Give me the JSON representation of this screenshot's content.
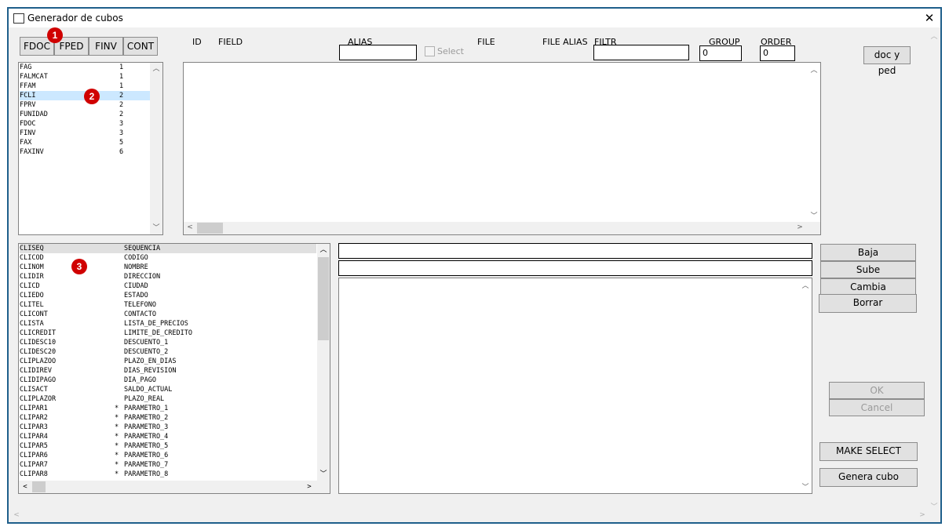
{
  "window": {
    "title": "Generador de cubos",
    "close_glyph": "✕"
  },
  "tabs": [
    "FDOC",
    "FPED",
    "FINV",
    "CONT"
  ],
  "headers": {
    "id": "ID",
    "field": "FIELD",
    "alias": "ALIAS",
    "select": "Select",
    "file": "FILE",
    "file_alias": "FILE ALIAS",
    "filtr": "FILTR",
    "group": "GROUP",
    "order": "ORDER"
  },
  "inputs": {
    "alias": "",
    "filtr": "",
    "group": "0",
    "order": "0"
  },
  "buttons": {
    "doc_ped": "doc y ped",
    "baja": "Baja",
    "sube": "Sube",
    "cambia": "Cambia",
    "borrar": "Borrar",
    "ok": "OK",
    "cancel": "Cancel",
    "make_select": "MAKE SELECT",
    "genera_cubo": "Genera cubo"
  },
  "tables_list": [
    {
      "name": "FAG",
      "value": "1"
    },
    {
      "name": "FALMCAT",
      "value": "1"
    },
    {
      "name": "FFAM",
      "value": "1"
    },
    {
      "name": "FCLI",
      "value": "2"
    },
    {
      "name": "FPRV",
      "value": "2"
    },
    {
      "name": "FUNIDAD",
      "value": "2"
    },
    {
      "name": "FDOC",
      "value": "3"
    },
    {
      "name": "FINV",
      "value": "3"
    },
    {
      "name": "FAX",
      "value": "5"
    },
    {
      "name": "FAXINV",
      "value": "6"
    }
  ],
  "selected_table_index": 3,
  "fields_list": [
    {
      "code": "CLISEQ",
      "mark": "",
      "desc": "SEQUENCIA"
    },
    {
      "code": "CLICOD",
      "mark": "",
      "desc": "CODIGO"
    },
    {
      "code": "CLINOM",
      "mark": "",
      "desc": "NOMBRE"
    },
    {
      "code": "CLIDIR",
      "mark": "",
      "desc": "DIRECCION"
    },
    {
      "code": "CLICD",
      "mark": "",
      "desc": "CIUDAD"
    },
    {
      "code": "CLIEDO",
      "mark": "",
      "desc": "ESTADO"
    },
    {
      "code": "CLITEL",
      "mark": "",
      "desc": "TELEFONO"
    },
    {
      "code": "CLICONT",
      "mark": "",
      "desc": "CONTACTO"
    },
    {
      "code": "CLISTA",
      "mark": "",
      "desc": "LISTA_DE_PRECIOS"
    },
    {
      "code": "CLICREDIT",
      "mark": "",
      "desc": "LIMITE_DE_CREDITO"
    },
    {
      "code": "CLIDESC10",
      "mark": "",
      "desc": "DESCUENTO_1"
    },
    {
      "code": "CLIDESC20",
      "mark": "",
      "desc": "DESCUENTO_2"
    },
    {
      "code": "CLIPLAZOO",
      "mark": "",
      "desc": "PLAZO_EN_DIAS"
    },
    {
      "code": "CLIDIREV",
      "mark": "",
      "desc": "DIAS_REVISION"
    },
    {
      "code": "CLIDIPAGO",
      "mark": "",
      "desc": "DIA_PAGO"
    },
    {
      "code": "CLISACT",
      "mark": "",
      "desc": "SALDO_ACTUAL"
    },
    {
      "code": "CLIPLAZOR",
      "mark": "",
      "desc": "PLAZO_REAL"
    },
    {
      "code": "CLIPAR1",
      "mark": "*",
      "desc": "PARAMETRO_1"
    },
    {
      "code": "CLIPAR2",
      "mark": "*",
      "desc": "PARAMETRO_2"
    },
    {
      "code": "CLIPAR3",
      "mark": "*",
      "desc": "PARAMETRO_3"
    },
    {
      "code": "CLIPAR4",
      "mark": "*",
      "desc": "PARAMETRO_4"
    },
    {
      "code": "CLIPAR5",
      "mark": "*",
      "desc": "PARAMETRO_5"
    },
    {
      "code": "CLIPAR6",
      "mark": "*",
      "desc": "PARAMETRO_6"
    },
    {
      "code": "CLIPAR7",
      "mark": "*",
      "desc": "PARAMETRO_7"
    },
    {
      "code": "CLIPAR8",
      "mark": "*",
      "desc": "PARAMETRO_8"
    }
  ],
  "selected_field_index": 0,
  "badges": [
    "1",
    "2",
    "3"
  ],
  "icons": {
    "scroll_up": "︿",
    "scroll_down": "﹀",
    "scroll_left": "<",
    "scroll_right": ">"
  },
  "colors": {
    "selection": "#cce8ff",
    "window_border": "#1f5f8b",
    "badge": "#d00000"
  }
}
